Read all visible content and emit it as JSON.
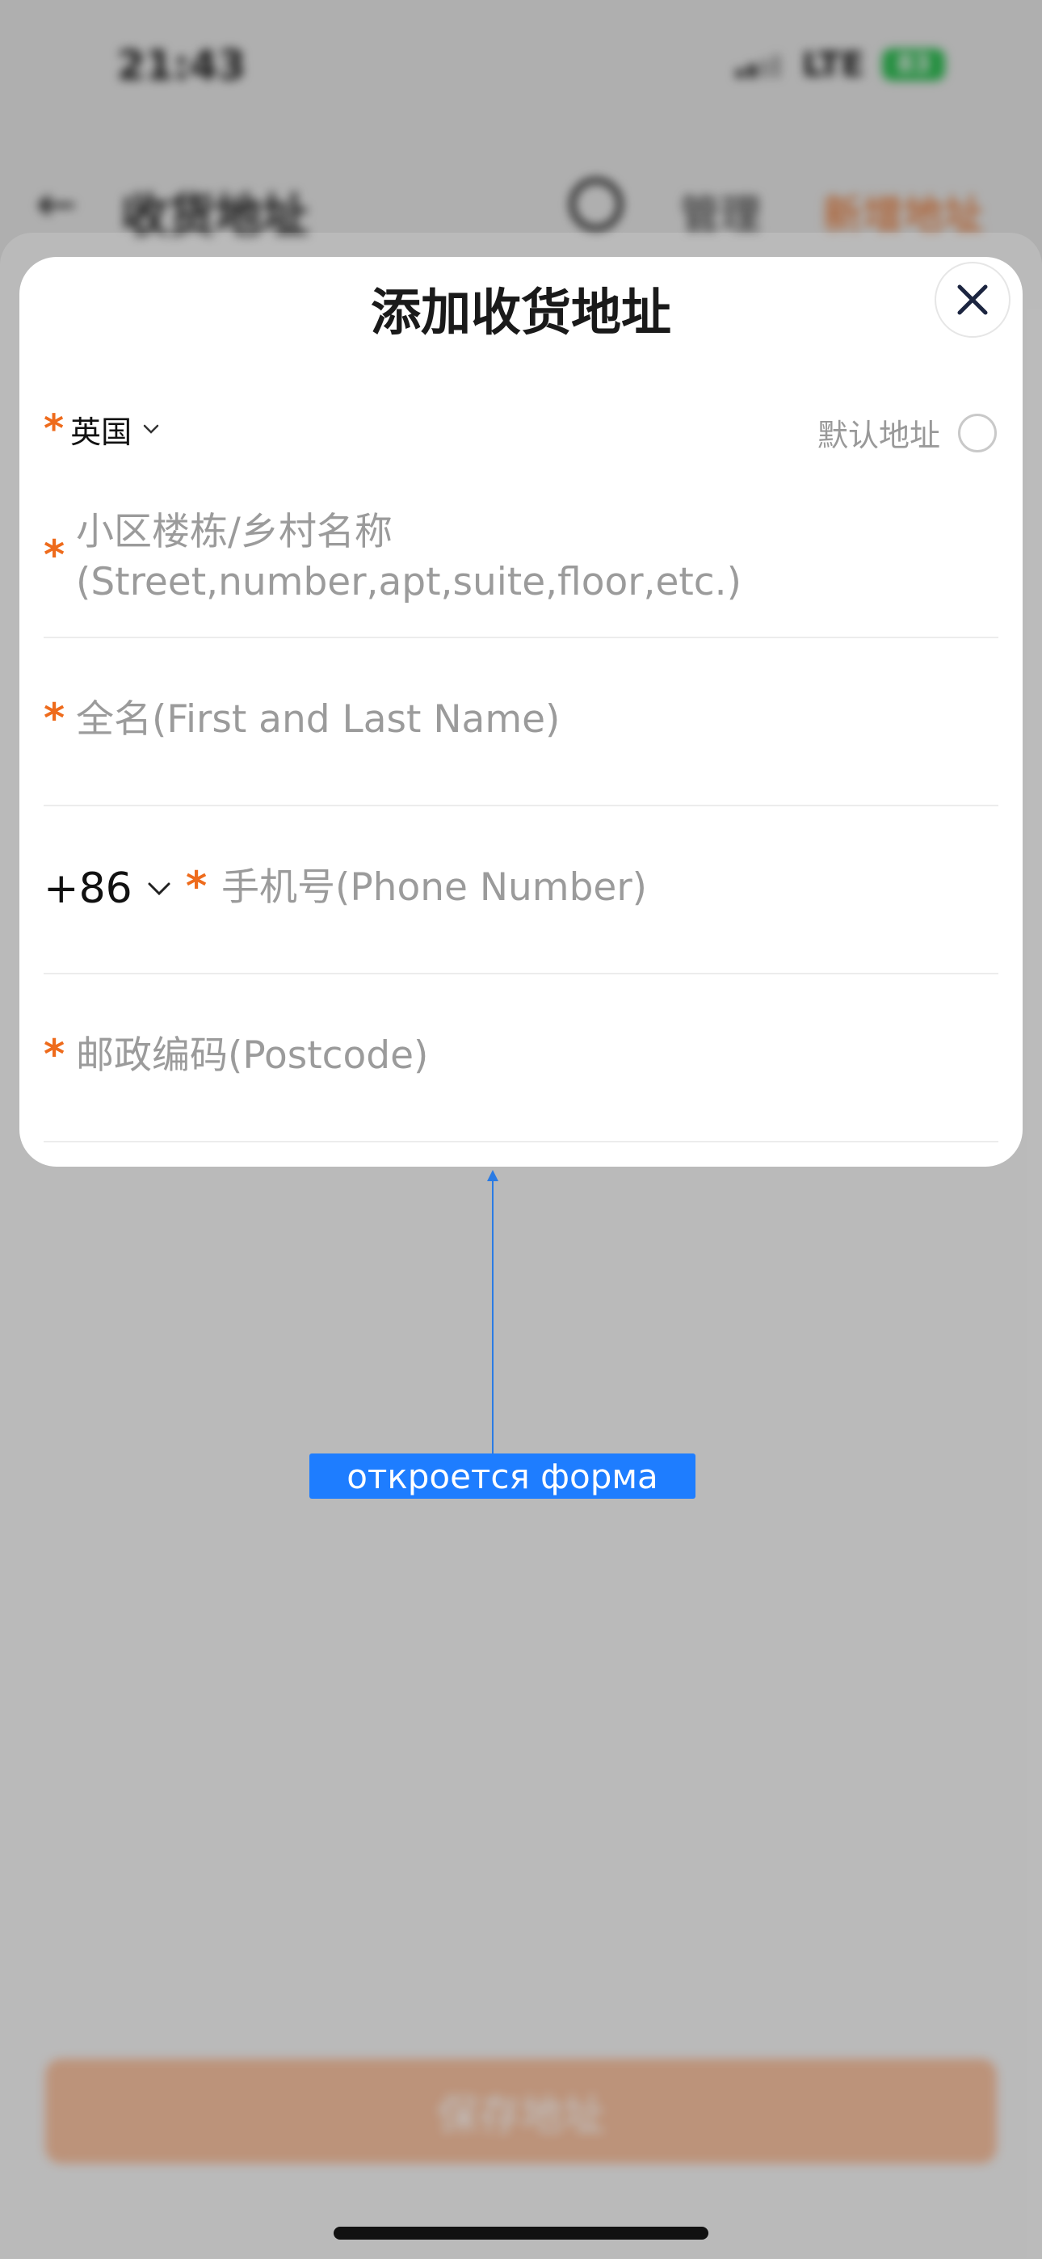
{
  "status_bar": {
    "time": "21:43",
    "network": "LTE",
    "battery": "83"
  },
  "nav": {
    "back_icon": "arrow-left-icon",
    "title": "收货地址",
    "search_icon": "search-icon",
    "manage_label": "管理",
    "add_label": "新增地址"
  },
  "modal": {
    "title": "添加收货地址",
    "close_icon": "close-icon",
    "country": {
      "required_mark": "*",
      "value": "英国",
      "chevron_icon": "chevron-down-icon"
    },
    "default_address": {
      "label": "默认地址",
      "checked": false
    },
    "fields": {
      "address": {
        "required_mark": "*",
        "placeholder_line1": "小区楼栋/乡村名称",
        "placeholder_line2": "(Street,number,apt,suite,floor,etc.)"
      },
      "name": {
        "required_mark": "*",
        "placeholder": "全名(First and Last Name)"
      },
      "phone": {
        "country_code": "+86",
        "required_mark": "*",
        "placeholder": "手机号(Phone Number)"
      },
      "postcode": {
        "required_mark": "*",
        "placeholder": "邮政编码(Postcode)"
      }
    }
  },
  "annotation": {
    "text": "откроется форма"
  },
  "save_button": {
    "label": "保存地址"
  },
  "colors": {
    "accent": "#ee6b1c",
    "annotation_blue": "#1e7dff",
    "placeholder": "#9b9b9b"
  }
}
